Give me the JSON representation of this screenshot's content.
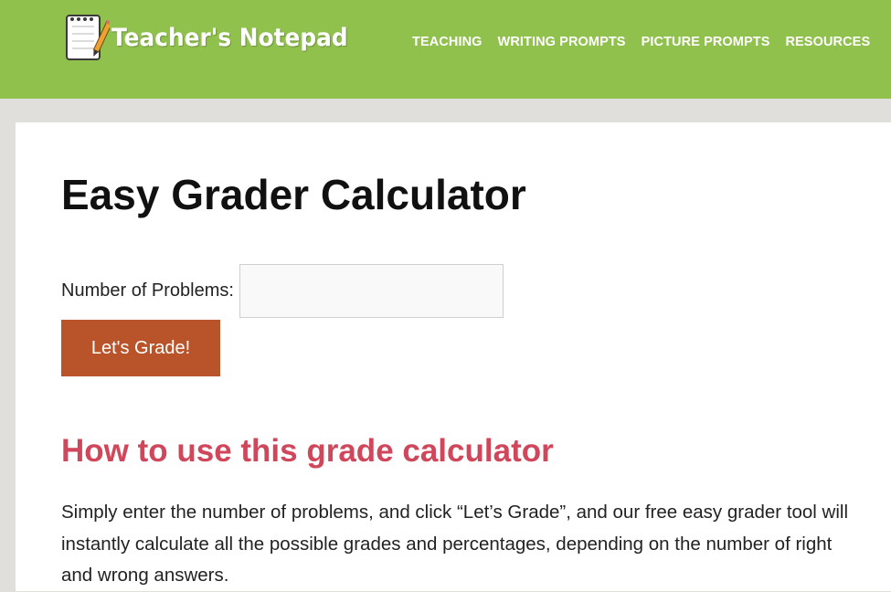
{
  "header": {
    "logo_text": "Teacher's Notepad",
    "nav": [
      {
        "label": "TEACHING"
      },
      {
        "label": "WRITING PROMPTS"
      },
      {
        "label": "PICTURE PROMPTS"
      },
      {
        "label": "RESOURCES"
      }
    ],
    "colors": {
      "background": "#90c14c",
      "text": "#ffffff"
    }
  },
  "main": {
    "title": "Easy Grader Calculator",
    "form": {
      "label": "Number of Problems:",
      "input_value": "",
      "button_label": "Let's Grade!",
      "button_color": "#b8532a"
    },
    "section": {
      "heading": "How to use this grade calculator",
      "heading_color": "#d0465a",
      "paragraph": "Simply enter the number of problems, and click “Let’s Grade”, and our free easy grader tool will instantly calculate all the possible grades and percentages, depending on the number of right and wrong answers."
    }
  },
  "icons": {
    "logo": "notepad-pencil-icon"
  }
}
